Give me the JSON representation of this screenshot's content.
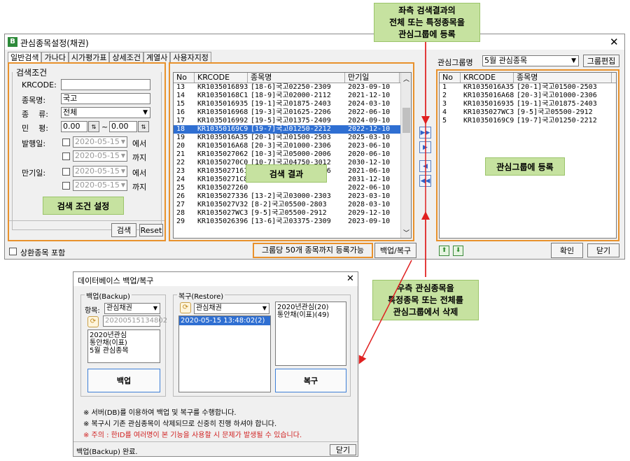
{
  "callouts": {
    "top": "좌측 검색결과의\n전체 또는 특정종목을\n관심그룹에 등록",
    "bottom": "우측 관심종목을\n특정종목 또는 전체를\n관심그룹에서 삭제"
  },
  "main": {
    "title": "관심종목설정(채권)",
    "tabs": [
      "일반검색",
      "가나다",
      "시가평가표",
      "상세조건",
      "계열사",
      "사용자지정"
    ],
    "search": {
      "group_label": "검색조건",
      "krcode_label": "KRCODE:",
      "name_label": "종목명:",
      "name_value": "국고",
      "type_label": "종    류:",
      "type_value": "전체",
      "rate_label": "민    평:",
      "rate_from": "0.00",
      "rate_tilde": "~",
      "rate_to": "0.00",
      "issue_label": "발행일:",
      "maturity_label": "만기일:",
      "date": "2020-05-15",
      "from_suffix": "에서",
      "to_suffix": "까지",
      "overlay": "검색 조건 설정",
      "search_btn": "검색",
      "reset_btn": "Reset"
    },
    "results": {
      "headers": [
        "No",
        "KRCODE",
        "종목명",
        "만기일"
      ],
      "rows": [
        [
          "13",
          "KR1035016893",
          "[18-6]국고02250-2309",
          "2023-09-10"
        ],
        [
          "14",
          "KR10350168C1",
          "[18-9]국고02000-2112",
          "2021-12-10"
        ],
        [
          "15",
          "KR1035016935",
          "[19-1]국고01875-2403",
          "2024-03-10"
        ],
        [
          "16",
          "KR1035016968",
          "[19-3]국고01625-2206",
          "2022-06-10"
        ],
        [
          "17",
          "KR1035016992",
          "[19-5]국고01375-2409",
          "2024-09-10"
        ],
        [
          "18",
          "KR10350169C9",
          "[19-7]국고01250-2212",
          "2022-12-10"
        ],
        [
          "19",
          "KR1035016A35",
          "[20-1]국고01500-2503",
          "2025-03-10"
        ],
        [
          "20",
          "KR1035016A68",
          "[20-3]국고01000-2306",
          "2023-06-10"
        ],
        [
          "21",
          "KR1035027062",
          "[10-3]국고05000-2006",
          "2020-06-10"
        ],
        [
          "22",
          "KR10350270C0",
          "[10-7]국고04750-3012",
          "2030-12-10"
        ],
        [
          "23",
          "KR1035027161",
          "[11-3]국고04250-2106",
          "2021-06-10"
        ],
        [
          "24",
          "KR10350271C8",
          "",
          "2031-12-10"
        ],
        [
          "25",
          "KR1035027260",
          "",
          "2022-06-10"
        ],
        [
          "26",
          "KR1035027336",
          "[13-2]국고03000-2303",
          "2023-03-10"
        ],
        [
          "27",
          "KR1035027V32",
          "[8-2]국고05500-2803",
          "2028-03-10"
        ],
        [
          "28",
          "KR1035027WC3",
          "[9-5]국고05500-2912",
          "2029-12-10"
        ],
        [
          "29",
          "KR1035026396",
          "[13-6]국고03375-2309",
          "2023-09-10"
        ]
      ],
      "selected_row": 5,
      "overlay": "검색 결과"
    },
    "group": {
      "label": "관심그룹명",
      "value": "5월 관심종목",
      "edit_btn": "그룹편집",
      "headers": [
        "No",
        "KRCODE",
        "종목명"
      ],
      "rows": [
        [
          "1",
          "KR1035016A35",
          "[20-1]국고01500-2503"
        ],
        [
          "2",
          "KR1035016A68",
          "[20-3]국고01000-2306"
        ],
        [
          "3",
          "KR1035016935",
          "[19-1]국고01875-2403"
        ],
        [
          "4",
          "KR1035027WC3",
          "[9-5]국고05500-2912"
        ],
        [
          "5",
          "KR10350169C9",
          "[19-7]국고01250-2212"
        ]
      ],
      "overlay": "관심그룹에 등록"
    },
    "footer": {
      "include_label": "상환종목 포함",
      "limit_text": "그룹당 50개 종목까지 등록가능",
      "backup_btn": "백업/복구",
      "ok_btn": "확인",
      "close_btn": "닫기"
    }
  },
  "dialog": {
    "title": "데이터베이스 백업/복구",
    "backup": {
      "group_label": "백업(Backup)",
      "item_label": "항목:",
      "item_value": "관심채권",
      "file": "20200515134802",
      "list": [
        "2020년관심",
        "통안채(이표)",
        "5월 관심종목"
      ],
      "btn": "백업"
    },
    "restore": {
      "group_label": "복구(Restore)",
      "item_value": "관심채권",
      "entries": [
        "2020-05-15 13:48:02(2)"
      ],
      "list": [
        "2020년관심(20)",
        "통안채(이표)(49)"
      ],
      "btn": "복구"
    },
    "notes": [
      "※ 서버(DB)를 이용하여 백업 및 복구를 수행합니다.",
      "※ 복구시 기존 관심종목이 삭제되므로 신중히 진행 하셔야 합니다.",
      "※ 주의 : 한ID를 여러명이 본 기능을 사용할 시 문제가 발생될 수 있습니다."
    ],
    "status": "백업(Backup) 완료.",
    "close_btn": "닫기"
  },
  "colors": {
    "accent": "#e8912c",
    "callout": "#c6e2a0",
    "arrow": "#e02020",
    "selection": "#2f6fd2"
  }
}
